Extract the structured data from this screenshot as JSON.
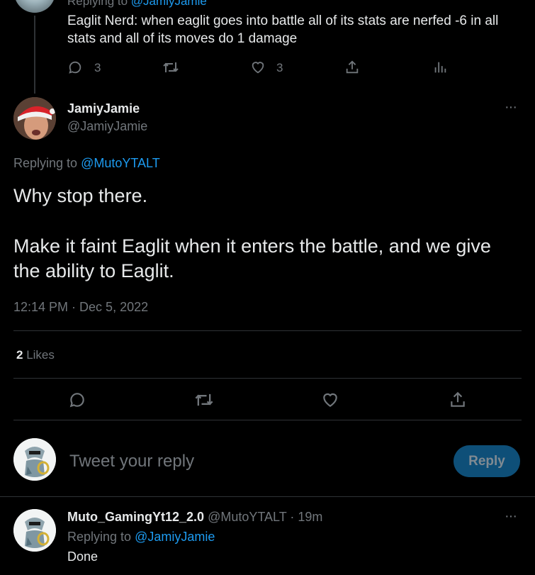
{
  "parent_tweet": {
    "replying_prefix": "Replying to",
    "replying_handle": "@JamiyJamie",
    "text": "Eaglit Nerd: when eaglit goes into battle all of its stats are nerfed -6 in all stats and all of its moves do 1 damage",
    "reply_count": "3",
    "like_count": "3"
  },
  "main_tweet": {
    "author_name": "JamiyJamie",
    "author_handle": "@JamiyJamie",
    "replying_prefix": "Replying to",
    "replying_handle": "@MutoYTALT",
    "text_line1": "Why stop there.",
    "text_line2": "Make it faint Eaglit when it enters the battle, and we give the ability to Eaglit.",
    "timestamp": "12:14 PM · Dec 5, 2022",
    "likes_count": "2",
    "likes_label": "Likes",
    "more_label": "···"
  },
  "composer": {
    "placeholder": "Tweet your reply",
    "reply_button": "Reply"
  },
  "reply_tweet": {
    "author_name": "Muto_GamingYt12_2.0",
    "author_handle": "@MutoYTALT",
    "time": "· 19m",
    "replying_prefix": "Replying to",
    "replying_handle": "@JamiyJamie",
    "text": "Done",
    "more_label": "···"
  },
  "icons": {
    "reply": "reply-icon",
    "retweet": "retweet-icon",
    "like": "heart-icon",
    "share": "share-icon",
    "analytics": "analytics-icon",
    "more": "more-icon"
  },
  "colors": {
    "background": "#000000",
    "text": "#e7e9ea",
    "muted": "#71767b",
    "link": "#1d9bf0",
    "divider": "#2f3336",
    "reply_button": "#0e4f78"
  }
}
